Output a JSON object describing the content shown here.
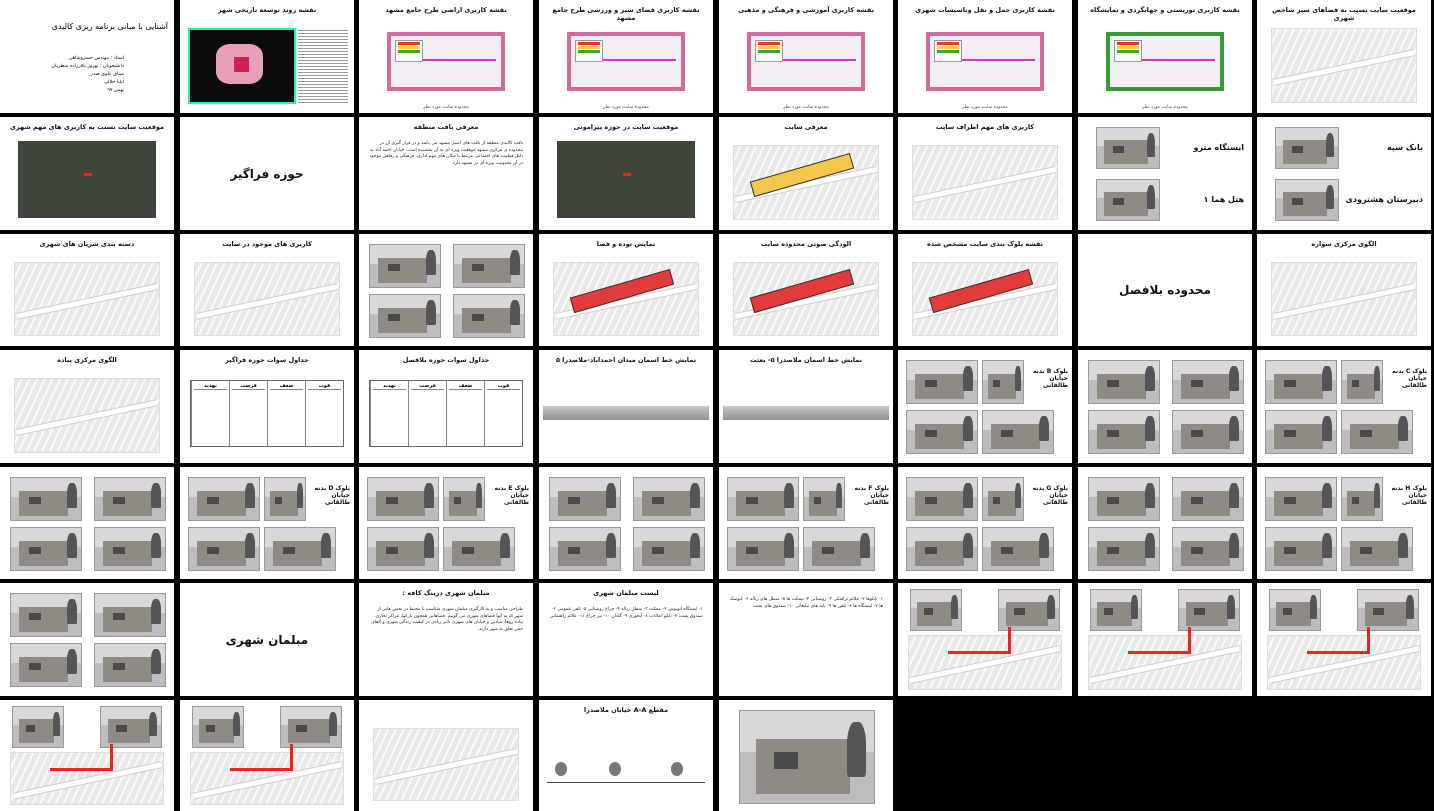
{
  "grid": {
    "columns": 8,
    "rows": 7
  },
  "slides": [
    {
      "id": "s01",
      "kind": "cover",
      "title": "آشنایی با مبانی برنامه ریزی کالبدی",
      "lines": [
        "استاد : مهندس خسروشاهی",
        "دانشجویان : بهروز باقرزاده سطریان",
        "مینای علوی صدر",
        "آیلنا جلالی",
        "بهمن ۹۷"
      ]
    },
    {
      "id": "s02",
      "kind": "map-dark",
      "title": "نقشه روند توسعه تاریخی شهر"
    },
    {
      "id": "s03",
      "kind": "map-pink",
      "title": "نقشه کاربری اراضی طرح جامع مشهد",
      "sub": "محدوده سایت مورد نظر"
    },
    {
      "id": "s04",
      "kind": "map-pink",
      "title": "نقشه کاربری فضای سبز و ورزشی طرح جامع مشهد",
      "sub": "محدوده سایت مورد نظر"
    },
    {
      "id": "s05",
      "kind": "map-pink",
      "title": "نقشه کاربری آموزشی و فرهنگی و مذهبی",
      "sub": "محدوده سایت مورد نظر"
    },
    {
      "id": "s06",
      "kind": "map-pink",
      "title": "نقشه کاربری حمل و نقل وتاسیسات شهری",
      "sub": "محدوده سایت مورد نظر"
    },
    {
      "id": "s07",
      "kind": "map-green",
      "title": "نقشه کاربری توریستی و جهانگردی و نمایشگاه",
      "sub": "محدوده سایت مورد نظر"
    },
    {
      "id": "s08",
      "kind": "map-streets",
      "title": "موقعیت سایت نسبت به فضاهای سبز شاخص شهری"
    },
    {
      "id": "s09",
      "kind": "sat",
      "title": "موقعیت سایت نسبت به کاربری های مهم شهری"
    },
    {
      "id": "s10",
      "kind": "big",
      "title": "حوزه فراگیر"
    },
    {
      "id": "s11",
      "kind": "text",
      "title": "معرفی بافت منطقه",
      "body": "بافت کالبدی منطقه از بافت های اصیل مشهد می باشد و در قرار گیری آن در محدوده ی مرکزی مشهد موقعیت ویژه ای به آن بخشیده است. خیابان احمد آباد به دلیل قطبیت های اجتماعی مرتبط با مکان های مهم اداری، فرهنگی و رفاهی موجود در آن محبوبیت ویژه ای در مشهد دارد."
    },
    {
      "id": "s12",
      "kind": "sat",
      "title": "موقعیت سایت در حوزه پیرامونی"
    },
    {
      "id": "s13",
      "kind": "site-yellow",
      "title": "معرفی سایت"
    },
    {
      "id": "s14",
      "kind": "map-streets",
      "title": "کاربری های مهم اطراف سایت"
    },
    {
      "id": "s15",
      "kind": "photos-labels",
      "labels": [
        "ایستگاه مترو",
        "هتل هما ۱"
      ]
    },
    {
      "id": "s16",
      "kind": "photos-labels",
      "labels": [
        "بانک سپه",
        "دبیرستان هشترودی"
      ]
    },
    {
      "id": "s17",
      "kind": "map-streets",
      "title": "دسته بندی شریان های شهری"
    },
    {
      "id": "s18",
      "kind": "map-streets",
      "title": "کاربری های موجود در سایت"
    },
    {
      "id": "s19",
      "kind": "photos",
      "title": ""
    },
    {
      "id": "s20",
      "kind": "site-red",
      "title": "نمایش توده و فضا"
    },
    {
      "id": "s21",
      "kind": "site-red",
      "title": "الودگی صوتی محدوده سایت"
    },
    {
      "id": "s22",
      "kind": "site-red",
      "title": "نقشه بلوک بندی سایت مشخص شده"
    },
    {
      "id": "s23",
      "kind": "big",
      "title": "محدوده بلافصل"
    },
    {
      "id": "s24",
      "kind": "map-streets",
      "title": "الگوی مرکزی سواره"
    },
    {
      "id": "s25",
      "kind": "map-streets",
      "title": "الگوی مرکزی پیاده"
    },
    {
      "id": "s26",
      "kind": "table",
      "title": "جداول سوات حوزه فراگیر",
      "cols": [
        "تهدید",
        "فرصت",
        "ضعف",
        "قوت"
      ]
    },
    {
      "id": "s27",
      "kind": "table",
      "title": "جداول سوات حوزه بلافصل",
      "cols": [
        "تهدید",
        "فرصت",
        "ضعف",
        "قوت"
      ]
    },
    {
      "id": "s28",
      "kind": "skyline",
      "title": "نمایش خط اسمان میدان احمداباد-ملاصدرا ۵"
    },
    {
      "id": "s29",
      "kind": "skyline",
      "title": "نمایش خط اسمان ملاصدرا ۵- بعثت"
    },
    {
      "id": "s30",
      "kind": "photos-block",
      "caption": "بلوک B بدنه خیابان طالقانی"
    },
    {
      "id": "s31",
      "kind": "photos",
      "title": ""
    },
    {
      "id": "s32",
      "kind": "photos-block",
      "caption": "بلوک C بدنه خیابان طالقانی"
    },
    {
      "id": "s33",
      "kind": "photos",
      "title": ""
    },
    {
      "id": "s34",
      "kind": "photos-block",
      "caption": "بلوک D بدنه خیابان طالقانی"
    },
    {
      "id": "s35",
      "kind": "photos-block",
      "caption": "بلوک E بدنه خیابان طالقانی"
    },
    {
      "id": "s36",
      "kind": "photos",
      "title": ""
    },
    {
      "id": "s37",
      "kind": "photos-block",
      "caption": "بلوک F بدنه خیابان طالقانی"
    },
    {
      "id": "s38",
      "kind": "photos-block",
      "caption": "بلوک G بدنه خیابان طالقانی"
    },
    {
      "id": "s39",
      "kind": "photos",
      "title": ""
    },
    {
      "id": "s40",
      "kind": "photos-block",
      "caption": "بلوک H بدنه خیابان طالقانی"
    },
    {
      "id": "s41",
      "kind": "photos",
      "title": ""
    },
    {
      "id": "s42",
      "kind": "big",
      "title": "مبلمان شهری"
    },
    {
      "id": "s43",
      "kind": "text",
      "title": "مبلمان شهری درینگ کافه :",
      "body": "طراحی مناسب و به کارگیری مبلمان شهری متناسب با محیط در بخش هایی از شهر که به آنها فضاهای شهری می گوییم. فضاهایی همچون پارکها، مراکز تجاری، پیاده روها، میادین و خیابان های شهری تاثیر زیادی در کیفیت زندگی شهری و القای حس تعلق به شهر دارند."
    },
    {
      "id": "s44",
      "kind": "text",
      "title": "لیست مبلمان شهری",
      "body": "۱- ایستگاه اتوبوس ۲- نیمکت ۳- سطل زباله ۴- چراغ روشنایی ۵- تلفن عمومی ۶- صندوق پست ۷- تابلو اعلانات ۸- آبخوری ۹- گلدان ۱۰- تیر چراغ ۱۱- علائم راهنمایی"
    },
    {
      "id": "s45",
      "kind": "text",
      "title": "",
      "body": "۱- تابلوها ۲- علائم ترافیکی ۳- روشنایی ۴- نیمکت ها ۵- سطل های زباله ۶- کیوسک ها ۷- ایستگاه ها ۸- تلفن ها ۹- پایه های تبلیغاتی ۱۰- صندوق های پست"
    },
    {
      "id": "s46",
      "kind": "photos-map",
      "title": ""
    },
    {
      "id": "s47",
      "kind": "photos-map",
      "title": ""
    },
    {
      "id": "s48",
      "kind": "photos-map",
      "title": ""
    },
    {
      "id": "s49",
      "kind": "photos-map",
      "title": ""
    },
    {
      "id": "s50",
      "kind": "photos-map",
      "title": ""
    },
    {
      "id": "s51",
      "kind": "map-streets",
      "title": "",
      "note": "مقطع A-A خیابان ملاصدرا"
    },
    {
      "id": "s52",
      "kind": "section",
      "title": "مقطع A-A خیابان ملاصدرا"
    },
    {
      "id": "s53",
      "kind": "photo-large",
      "title": ""
    }
  ]
}
